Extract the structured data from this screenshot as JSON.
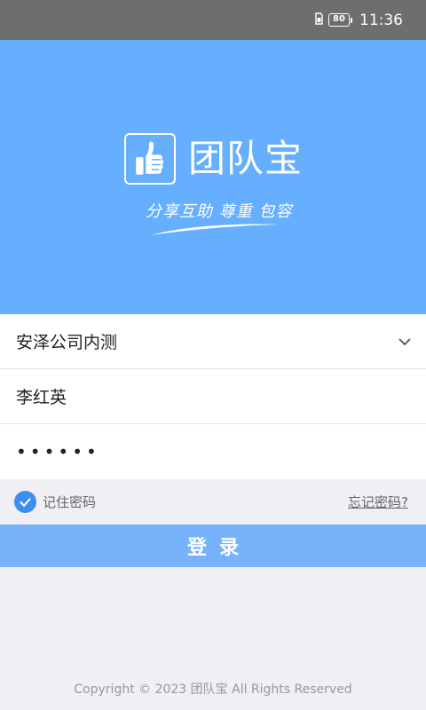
{
  "status_bar": {
    "battery_level": "80",
    "time": "11:36"
  },
  "hero": {
    "logo_icon": "thumbs-up-icon",
    "brand_name": "团队宝",
    "slogan": "分享互助 尊重 包容",
    "colors": {
      "background": "#66aefe"
    }
  },
  "form": {
    "company": "安泽公司内测",
    "username": "李红英",
    "password": "••••••"
  },
  "options": {
    "remember_checked": true,
    "remember_label": "记住密码",
    "forgot_link": "忘记密码?"
  },
  "login_button": {
    "label": "登录",
    "color": "#77b2fb"
  },
  "footer": {
    "copyright": "Copyright © 2023 团队宝 All Rights Reserved"
  }
}
